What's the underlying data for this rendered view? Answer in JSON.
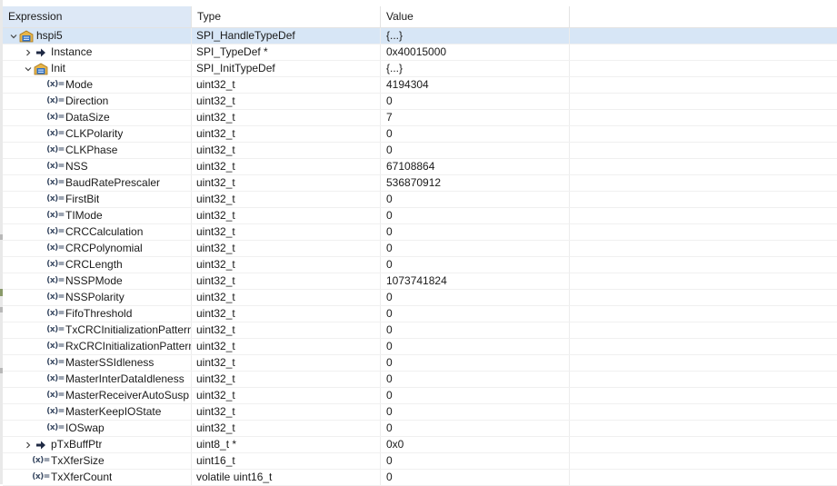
{
  "columns": {
    "expression": "Expression",
    "type": "Type",
    "value": "Value"
  },
  "icon_names": {
    "struct": "struct-variable-icon",
    "pointer": "pointer-arrow-icon",
    "variable": "variable-x-icon"
  },
  "variable_icon_glyph": "(x)=",
  "colors": {
    "selected_row": "#d7e6f6",
    "header_active": "#dde8f6"
  },
  "rows": [
    {
      "indent": 0,
      "twisty": "expanded",
      "icon": "struct",
      "name": "hspi5",
      "type": "SPI_HandleTypeDef",
      "value": "{...}",
      "selected": true
    },
    {
      "indent": 1,
      "twisty": "collapsed",
      "icon": "pointer",
      "name": "Instance",
      "type": "SPI_TypeDef *",
      "value": "0x40015000"
    },
    {
      "indent": 1,
      "twisty": "expanded",
      "icon": "struct",
      "name": "Init",
      "type": "SPI_InitTypeDef",
      "value": "{...}"
    },
    {
      "indent": 2,
      "twisty": "none",
      "icon": "variable",
      "name": "Mode",
      "type": "uint32_t",
      "value": "4194304"
    },
    {
      "indent": 2,
      "twisty": "none",
      "icon": "variable",
      "name": "Direction",
      "type": "uint32_t",
      "value": "0"
    },
    {
      "indent": 2,
      "twisty": "none",
      "icon": "variable",
      "name": "DataSize",
      "type": "uint32_t",
      "value": "7"
    },
    {
      "indent": 2,
      "twisty": "none",
      "icon": "variable",
      "name": "CLKPolarity",
      "type": "uint32_t",
      "value": "0"
    },
    {
      "indent": 2,
      "twisty": "none",
      "icon": "variable",
      "name": "CLKPhase",
      "type": "uint32_t",
      "value": "0"
    },
    {
      "indent": 2,
      "twisty": "none",
      "icon": "variable",
      "name": "NSS",
      "type": "uint32_t",
      "value": "67108864"
    },
    {
      "indent": 2,
      "twisty": "none",
      "icon": "variable",
      "name": "BaudRatePrescaler",
      "type": "uint32_t",
      "value": "536870912"
    },
    {
      "indent": 2,
      "twisty": "none",
      "icon": "variable",
      "name": "FirstBit",
      "type": "uint32_t",
      "value": "0"
    },
    {
      "indent": 2,
      "twisty": "none",
      "icon": "variable",
      "name": "TIMode",
      "type": "uint32_t",
      "value": "0"
    },
    {
      "indent": 2,
      "twisty": "none",
      "icon": "variable",
      "name": "CRCCalculation",
      "type": "uint32_t",
      "value": "0"
    },
    {
      "indent": 2,
      "twisty": "none",
      "icon": "variable",
      "name": "CRCPolynomial",
      "type": "uint32_t",
      "value": "0"
    },
    {
      "indent": 2,
      "twisty": "none",
      "icon": "variable",
      "name": "CRCLength",
      "type": "uint32_t",
      "value": "0"
    },
    {
      "indent": 2,
      "twisty": "none",
      "icon": "variable",
      "name": "NSSPMode",
      "type": "uint32_t",
      "value": "1073741824"
    },
    {
      "indent": 2,
      "twisty": "none",
      "icon": "variable",
      "name": "NSSPolarity",
      "type": "uint32_t",
      "value": "0"
    },
    {
      "indent": 2,
      "twisty": "none",
      "icon": "variable",
      "name": "FifoThreshold",
      "type": "uint32_t",
      "value": "0"
    },
    {
      "indent": 2,
      "twisty": "none",
      "icon": "variable",
      "name": "TxCRCInitializationPattern",
      "type": "uint32_t",
      "value": "0"
    },
    {
      "indent": 2,
      "twisty": "none",
      "icon": "variable",
      "name": "RxCRCInitializationPattern",
      "type": "uint32_t",
      "value": "0"
    },
    {
      "indent": 2,
      "twisty": "none",
      "icon": "variable",
      "name": "MasterSSIdleness",
      "type": "uint32_t",
      "value": "0"
    },
    {
      "indent": 2,
      "twisty": "none",
      "icon": "variable",
      "name": "MasterInterDataIdleness",
      "type": "uint32_t",
      "value": "0"
    },
    {
      "indent": 2,
      "twisty": "none",
      "icon": "variable",
      "name": "MasterReceiverAutoSusp",
      "type": "uint32_t",
      "value": "0"
    },
    {
      "indent": 2,
      "twisty": "none",
      "icon": "variable",
      "name": "MasterKeepIOState",
      "type": "uint32_t",
      "value": "0"
    },
    {
      "indent": 2,
      "twisty": "none",
      "icon": "variable",
      "name": "IOSwap",
      "type": "uint32_t",
      "value": "0"
    },
    {
      "indent": 1,
      "twisty": "collapsed",
      "icon": "pointer",
      "name": "pTxBuffPtr",
      "type": "uint8_t *",
      "value": "0x0"
    },
    {
      "indent": 1,
      "twisty": "none",
      "icon": "variable",
      "name": "TxXferSize",
      "type": "uint16_t",
      "value": "0"
    },
    {
      "indent": 1,
      "twisty": "none",
      "icon": "variable",
      "name": "TxXferCount",
      "type": "volatile uint16_t",
      "value": "0"
    }
  ]
}
